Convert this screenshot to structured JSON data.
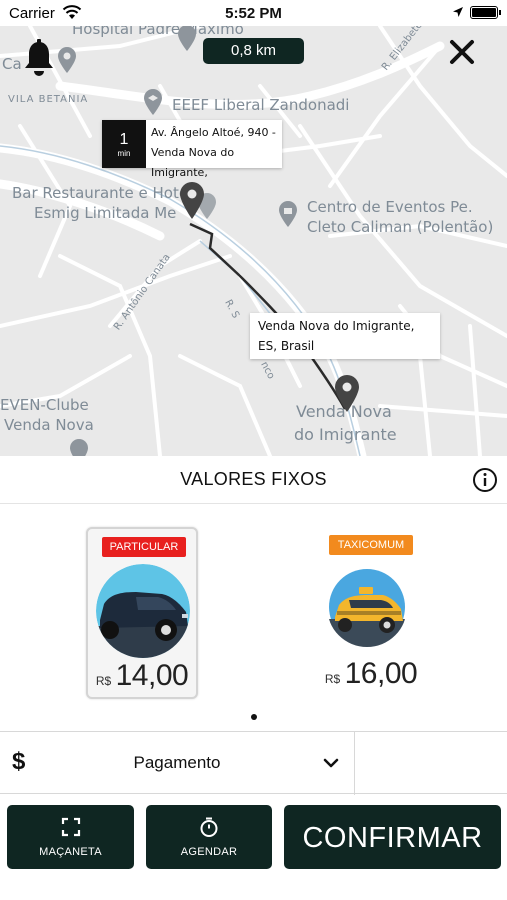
{
  "status_bar": {
    "carrier": "Carrier",
    "time": "5:52 PM"
  },
  "map": {
    "distance": "0,8 km",
    "origin": {
      "eta_value": "1",
      "eta_unit": "min",
      "address": "Av. Ângelo Altoé, 940 - Venda Nova do Imigrante,"
    },
    "destination": {
      "address": "Venda Nova do Imigrante, ES, Brasil"
    },
    "labels": {
      "hospital": "Hospital Padre Maximo",
      "cafe": "Ca",
      "vila": "VILA BETANIA",
      "school": "EEEF Liberal Zandonadi",
      "bar_line1": "Bar Restaurante e Hotel",
      "bar_line2": "Esmig Limitada Me",
      "centro_line1": "Centro de Eventos Pe.",
      "centro_line2": "Cleto Caliman (Polentão)",
      "street_elizabete": "R. Elizabete Perin",
      "street_antonio": "R. Antônio Canata",
      "street_s": "R. S",
      "street_nco": "nco",
      "even_line1": "EVEN-Clube",
      "even_line2": "Venda Nova",
      "town_line1": "Venda Nova",
      "town_line2": "do Imigrante"
    }
  },
  "panel": {
    "title": "VALORES FIXOS",
    "options": [
      {
        "badge": "PARTICULAR",
        "badge_color": "#e8201e",
        "currency": "R$",
        "price": "14,00",
        "selected": true
      },
      {
        "badge": "TAXICOMUM",
        "badge_color": "#f28a1e",
        "currency": "R$",
        "price": "16,00",
        "selected": false
      }
    ]
  },
  "payment": {
    "icon": "$",
    "label": "Pagamento"
  },
  "actions": {
    "macaneta": "MAÇANETA",
    "agendar": "AGENDAR",
    "confirmar": "CONFIRMAR"
  },
  "colors": {
    "dark_button": "#0f2622",
    "map_bg": "#e9e9e9",
    "route": "#2b2b2b"
  }
}
